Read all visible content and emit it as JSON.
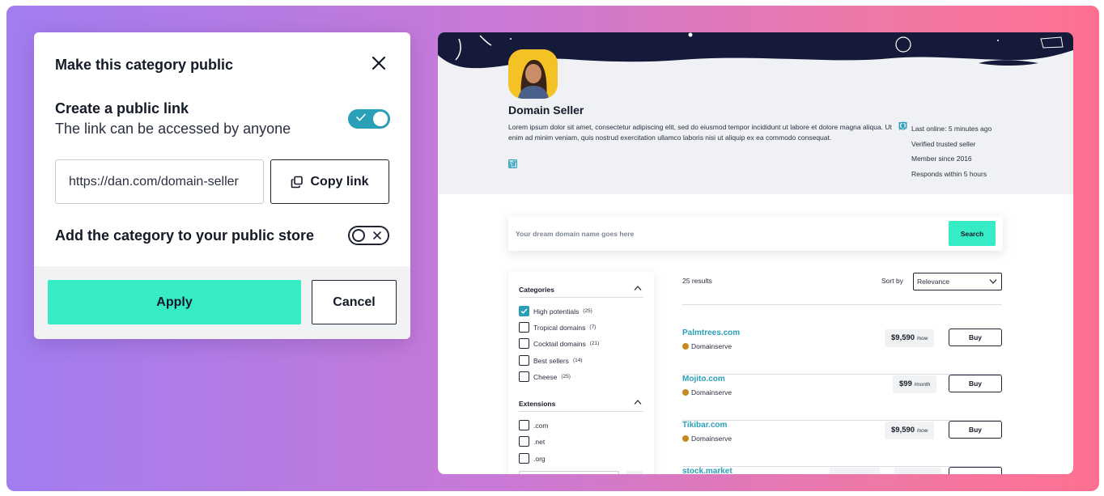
{
  "modal": {
    "title": "Make this category public",
    "public_link_title": "Create a public link",
    "public_link_subtitle": "The link can be accessed by anyone",
    "public_link_enabled": true,
    "url_value": "https://dan.com/domain-seller",
    "copy_label": "Copy link",
    "store_label": "Add the category to your public store",
    "store_enabled": false,
    "apply_label": "Apply",
    "cancel_label": "Cancel"
  },
  "profile": {
    "name": "Domain Seller",
    "description": "Lorem ipsum dolor sit amet, consectetur adipiscing elit, sed do eiusmod tempor incididunt ut labore et dolore magna aliqua. Ut enim ad minim veniam, quis nostrud exercitation ullamco laboris nisi ut aliquip ex ea commodo consequat.",
    "socials": [
      "twitter-icon",
      "facebook-icon",
      "linkedin-icon"
    ],
    "stats": [
      {
        "icon": "online-dot-icon",
        "text": "Last online: 5 minutes ago"
      },
      {
        "icon": "shield-check-icon",
        "text": "Verified trusted seller"
      },
      {
        "icon": "user-circle-icon",
        "text": "Member since 2016"
      },
      {
        "icon": "chat-check-icon",
        "text": "Responds within 5 hours"
      }
    ]
  },
  "search": {
    "placeholder": "Your dream domain name goes here",
    "button_label": "Search"
  },
  "filters": {
    "categories_title": "Categories",
    "categories": [
      {
        "label": "High potentials",
        "count": "(25)",
        "checked": true
      },
      {
        "label": "Tropical domains",
        "count": "(7)",
        "checked": false
      },
      {
        "label": "Cocktail domains",
        "count": "(21)",
        "checked": false
      },
      {
        "label": "Best sellers",
        "count": "(14)",
        "checked": false
      },
      {
        "label": "Cheese",
        "count": "(25)",
        "checked": false
      }
    ],
    "extensions_title": "Extensions",
    "extensions": [
      {
        "label": ".com",
        "checked": false
      },
      {
        "label": ".net",
        "checked": false
      },
      {
        "label": ".org",
        "checked": false
      }
    ]
  },
  "results": {
    "count_label": "25 results",
    "sort_label": "Sort by",
    "sort_value": "Relevance",
    "items": [
      {
        "name": "Palmtrees.com",
        "seller": "Domainserve",
        "price": "$9,590",
        "period": "/now",
        "buy": "Buy"
      },
      {
        "name": "Mojito.com",
        "seller": "Domainserve",
        "price": "$99",
        "period": "/month",
        "buy": "Buy"
      },
      {
        "name": "Tikibar.com",
        "seller": "Domainserve",
        "price": "$9,590",
        "period": "/now",
        "buy": "Buy"
      },
      {
        "name": "stock.market",
        "seller": "",
        "price": "",
        "period": "",
        "buy": ""
      }
    ]
  },
  "colors": {
    "accent_green": "#36ecc5",
    "accent_teal": "#2a9fb8",
    "ink": "#151a28",
    "banner_dark": "#151a3a"
  }
}
